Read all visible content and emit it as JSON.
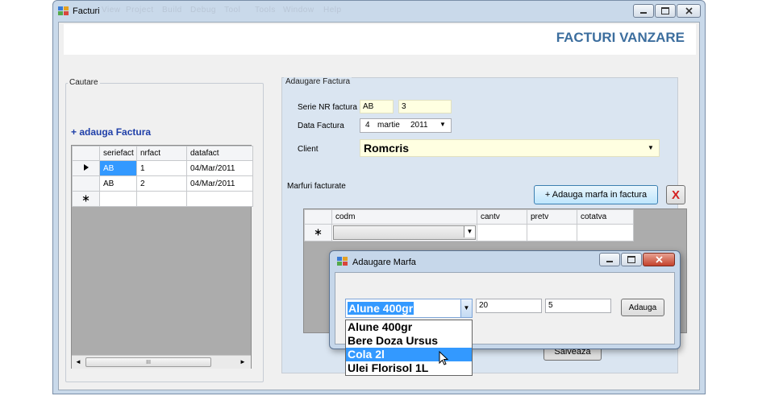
{
  "window": {
    "title": "Facturi",
    "ghost_menu": [
      "View",
      "Project",
      "Build",
      "Debug",
      "Tool",
      "Tools",
      "Window",
      "Help"
    ]
  },
  "banner": {
    "title": "FACTURI VANZARE"
  },
  "cautare": {
    "group_title": "Cautare",
    "add_link": "+ adauga Factura",
    "columns": [
      "seriefact",
      "nrfact",
      "datafact"
    ],
    "rows": [
      {
        "seriefact": "AB",
        "nrfact": "1",
        "datafact": "04/Mar/2011"
      },
      {
        "seriefact": "AB",
        "nrfact": "2",
        "datafact": "04/Mar/2011"
      }
    ],
    "scroll_grip": "III"
  },
  "adaugare": {
    "group_title": "Adaugare Factura",
    "serie_label": "Serie NR factura",
    "serie_value": "AB",
    "nr_value": "3",
    "data_label": "Data Factura",
    "date_day": "4",
    "date_month": "martie",
    "date_year": "2011",
    "client_label": "Client",
    "client_value": "Romcris",
    "marfuri_label": "Marfuri facturate",
    "add_marfa_button": "+ Adauga marfa in factura",
    "delete_button": "X",
    "marfa_columns": [
      "codm",
      "cantv",
      "pretv",
      "cotatva"
    ],
    "save_button": "Salveaza"
  },
  "dialog": {
    "title": "Adaugare Marfa",
    "product_selected": "Alune 400gr",
    "qty_value": "20",
    "price_value": "5",
    "add_button": "Adauga",
    "options": [
      "Alune 400gr",
      "Bere Doza Ursus",
      "Cola 2l",
      "Ulei Florisol 1L"
    ],
    "highlighted_index": 2
  },
  "colors": {
    "accent": "#3c6e9e",
    "link": "#1f3fa8",
    "selection": "#3399ff",
    "input_yellow": "#ffffe1"
  }
}
